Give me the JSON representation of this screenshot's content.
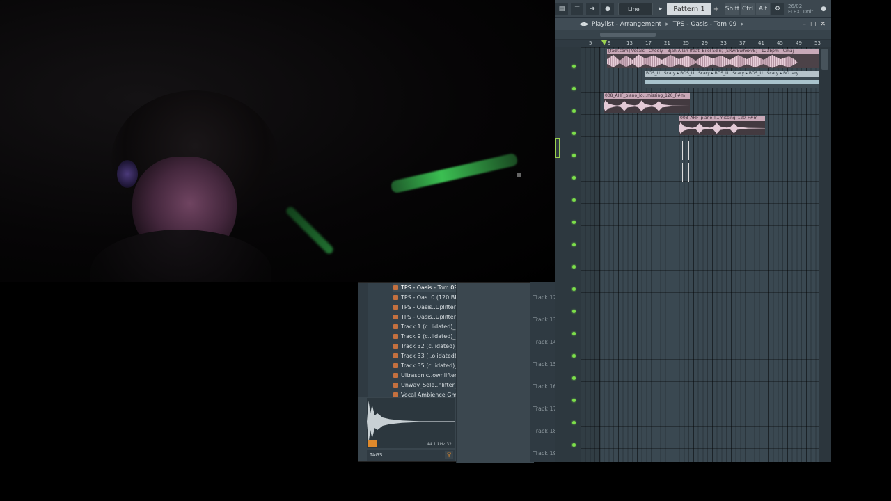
{
  "toolbar": {
    "snap": "Line",
    "pattern": "Pattern 1",
    "plus": "+",
    "keys": [
      "Shift",
      "Ctrl",
      "Alt"
    ],
    "date": "26/02",
    "status": "FLEX: Dnlt."
  },
  "playlist": {
    "title": "Playlist - Arrangement",
    "project": "TPS - Oasis - Tom 09",
    "bar_numbers": [
      "5",
      "9",
      "13",
      "17",
      "21",
      "25",
      "29",
      "33",
      "37",
      "41",
      "45",
      "49",
      "53"
    ],
    "clips": [
      {
        "name": "[fadr.com] Vocals - Chedly - Bjah Allah (feat. Bilel Sdiri) [SRwrEwhxxvE] - 123bpm - Cmaj",
        "type": "vocal"
      },
      {
        "name": "BOS_U...Scary ▸ BOS_U...Scary ▸ BOS_U...Scary ▸ BOS_U...Scary ▸ BO..ary",
        "type": "scary"
      },
      {
        "name": "008_AHF_piano_lo...missing_120_F#m",
        "type": "piano"
      },
      {
        "name": "008_AHF_piano_l...missing_120_F#m",
        "type": "piano"
      }
    ],
    "track_labels": [
      "Track 12",
      "Track 13",
      "Track 14",
      "Track 15",
      "Track 16",
      "Track 17",
      "Track 18",
      "Track 19"
    ]
  },
  "browser": {
    "items": [
      "TPS - Oasis - Tom 09",
      "TPS - Oas..0 (120 BPM)",
      "TPS - Oasis..Uplifter 03",
      "TPS - Oasis..Uplifter 07",
      "Track 1 (c..lidated)_31",
      "Track 9 (c..lidated)_25",
      "Track 32 (c..idated)_13",
      "Track 33 (..olidated)_9",
      "Track 35 (c..idated)_13",
      "Ultrasonic..ownlifter 02",
      "Unwav_Sele..nlifter_01",
      "Vocal Ambience Gmin"
    ],
    "selected_index": 0,
    "sample_rate": "44.1 kHz 32",
    "tags_label": "TAGS"
  }
}
